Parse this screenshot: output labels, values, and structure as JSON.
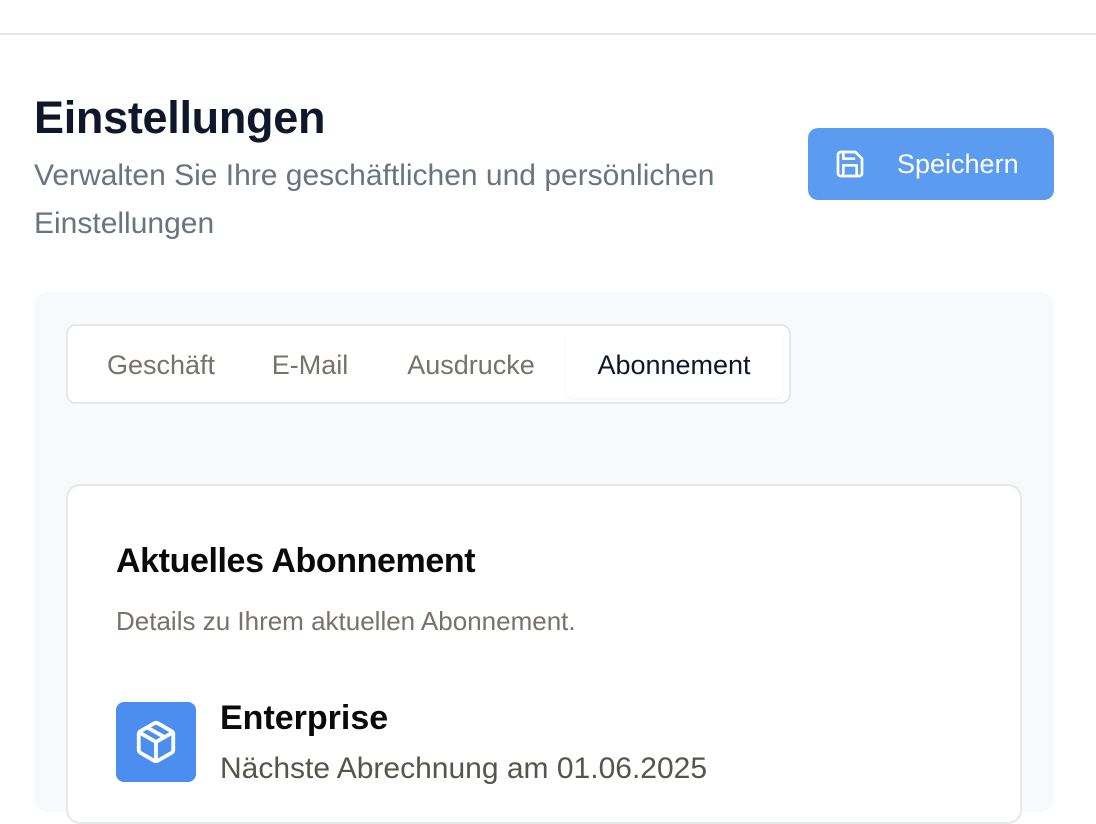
{
  "header": {
    "title": "Einstellungen",
    "subtitle": "Verwalten Sie Ihre geschäftlichen und persönlichen Einstellungen",
    "save_label": "Speichern"
  },
  "tabs": [
    {
      "label": "Geschäft",
      "active": false
    },
    {
      "label": "E-Mail",
      "active": false
    },
    {
      "label": "Ausdrucke",
      "active": false
    },
    {
      "label": "Abonnement",
      "active": true
    }
  ],
  "subscription": {
    "title": "Aktuelles Abonnement",
    "description": "Details zu Ihrem aktuellen Abonnement.",
    "plan_name": "Enterprise",
    "next_billing": "Nächste Abrechnung am 01.06.2025",
    "plan_icon": "package-icon"
  },
  "colors": {
    "primary": "#5b9cf0",
    "plan_icon_bg": "#4c8df0",
    "panel_bg": "#f8f9fb",
    "border": "#e5e7eb"
  }
}
